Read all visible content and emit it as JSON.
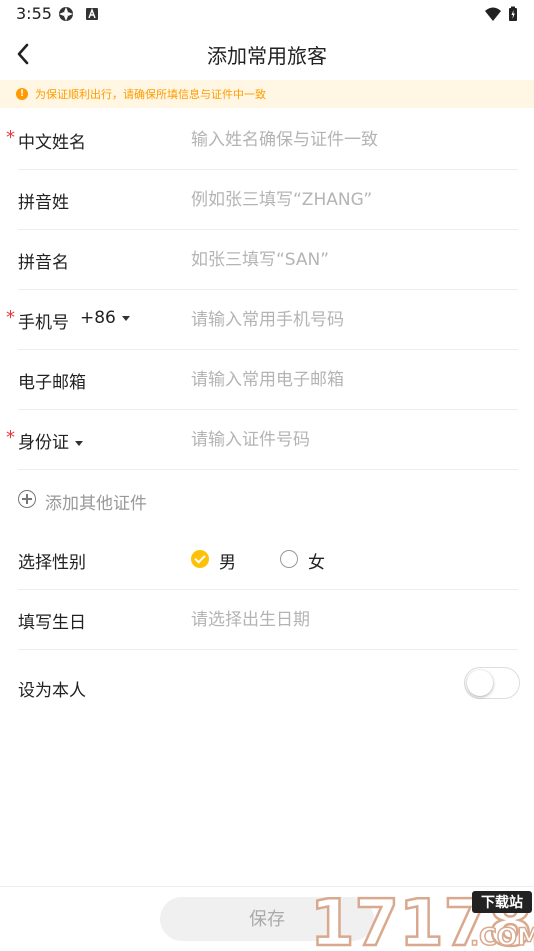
{
  "status_bar": {
    "time": "3:55"
  },
  "header": {
    "title": "添加常用旅客"
  },
  "notice": {
    "icon": "!",
    "text": "为保证顺利出行，请确保所填信息与证件中一致"
  },
  "form": {
    "chinese_name": {
      "label": "中文姓名",
      "placeholder": "输入姓名确保与证件一致"
    },
    "pinyin_surname": {
      "label": "拼音姓",
      "placeholder": "例如张三填写“ZHANG”"
    },
    "pinyin_given": {
      "label": "拼音名",
      "placeholder": "如张三填写“SAN”"
    },
    "phone": {
      "label": "手机号",
      "country_code": "+86",
      "placeholder": "请输入常用手机号码"
    },
    "email": {
      "label": "电子邮箱",
      "placeholder": "请输入常用电子邮箱"
    },
    "id_type": {
      "label": "身份证",
      "placeholder": "请输入证件号码"
    },
    "add_other_id": "添加其他证件",
    "gender": {
      "label": "选择性别",
      "options": [
        "男",
        "女"
      ],
      "selected": "男"
    },
    "birthday": {
      "label": "填写生日",
      "placeholder": "请选择出生日期"
    },
    "set_self": {
      "label": "设为本人",
      "on": false
    },
    "required_mark": "*"
  },
  "footer": {
    "save_label": "保存"
  },
  "watermark": {
    "number": "17178",
    "badge": "下载站",
    "suffix": ".COM"
  },
  "colors": {
    "accent": "#ffc107",
    "required": "#e7373f",
    "notice_bg": "#fff7e3",
    "notice_text": "#ff9b00",
    "placeholder": "#b4b4b4"
  }
}
